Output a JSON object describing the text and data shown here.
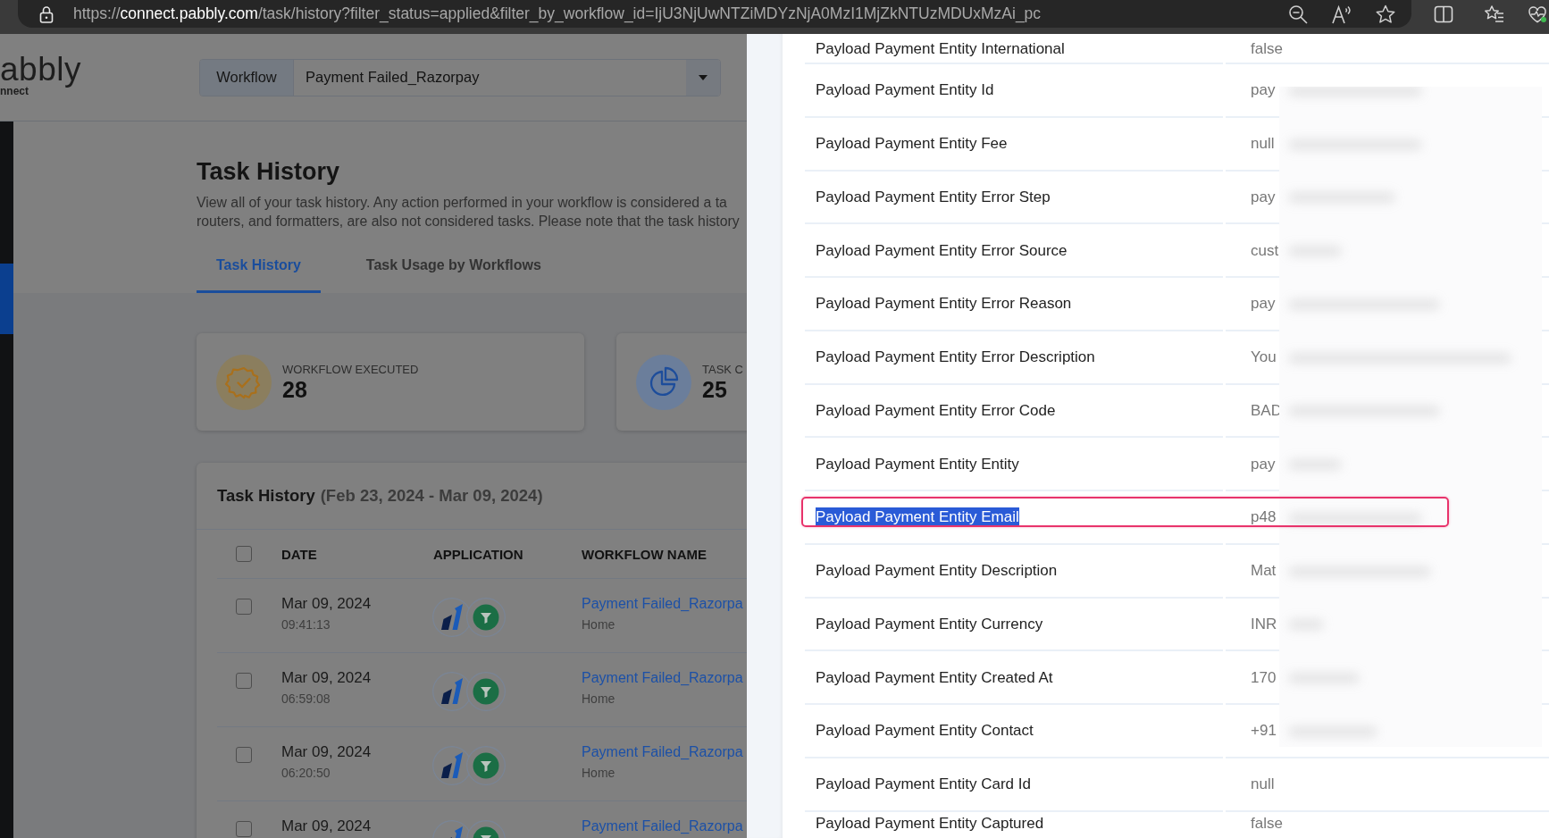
{
  "browser": {
    "url_scheme": "https://",
    "url_host": "connect.pabbly.com",
    "url_path": "/task/history?filter_status=applied&filter_by_workflow_id=IjU3NjUwNTZiMDYzNjA0MzI1MjZkNTUzMDUxMzAi_pc"
  },
  "header": {
    "logo": "abbly",
    "logo_sub": "nnect",
    "workflow_label": "Workflow",
    "workflow_value": "Payment Failed_Razorpay"
  },
  "page": {
    "title": "Task History",
    "description": [
      "View all of your task history. Any action performed in your workflow is considered a ta",
      "routers, and formatters, are also not considered tasks. Please note that the task history"
    ],
    "tabs": [
      {
        "label": "Task History",
        "selected": true
      },
      {
        "label": "Task Usage by Workflows",
        "selected": false
      }
    ]
  },
  "stats": [
    {
      "kind": "executed",
      "label": "WORKFLOW EXECUTED",
      "value": "28"
    },
    {
      "kind": "consumed",
      "label": "TASK C",
      "value": "25"
    }
  ],
  "task_table": {
    "title": "Task History",
    "range": "(Feb 23, 2024 - Mar 09, 2024)",
    "header_checked": false,
    "columns": [
      "DATE",
      "APPLICATION",
      "WORKFLOW NAME"
    ],
    "rows": [
      {
        "checked": false,
        "date": "Mar 09, 2024",
        "time": "09:41:13",
        "workflow": "Payment Failed_Razorpa",
        "folder": "Home"
      },
      {
        "checked": false,
        "date": "Mar 09, 2024",
        "time": "06:59:08",
        "workflow": "Payment Failed_Razorpa",
        "folder": "Home"
      },
      {
        "checked": false,
        "date": "Mar 09, 2024",
        "time": "06:20:50",
        "workflow": "Payment Failed_Razorpa",
        "folder": "Home"
      },
      {
        "checked": false,
        "date": "Mar 09, 2024",
        "workflow": "Payment Failed_Razorpa"
      }
    ]
  },
  "payload": {
    "rows": [
      {
        "field": "Payload Payment Entity International",
        "value": "false",
        "selected_text": false,
        "circled": false
      },
      {
        "field": "Payload Payment Entity Id",
        "value": "pay",
        "selected_text": false,
        "circled": false
      },
      {
        "field": "Payload Payment Entity Fee",
        "value": "null",
        "selected_text": false,
        "circled": false
      },
      {
        "field": "Payload Payment Entity Error Step",
        "value": "pay",
        "selected_text": false,
        "circled": false
      },
      {
        "field": "Payload Payment Entity Error Source",
        "value": "cust",
        "selected_text": false,
        "circled": false
      },
      {
        "field": "Payload Payment Entity Error Reason",
        "value": "pay",
        "selected_text": false,
        "circled": false
      },
      {
        "field": "Payload Payment Entity Error Description",
        "value": "You",
        "selected_text": false,
        "circled": false
      },
      {
        "field": "Payload Payment Entity Error Code",
        "value": "BAD",
        "selected_text": false,
        "circled": false
      },
      {
        "field": "Payload Payment Entity Entity",
        "value": "pay",
        "selected_text": false,
        "circled": false
      },
      {
        "field": "Payload Payment Entity Email",
        "value": "p48",
        "selected_text": true,
        "circled": true
      },
      {
        "field": "Payload Payment Entity Description",
        "value": "Mat",
        "selected_text": false,
        "circled": false
      },
      {
        "field": "Payload Payment Entity Currency",
        "value": "INR",
        "selected_text": false,
        "circled": false
      },
      {
        "field": "Payload Payment Entity Created At",
        "value": "170",
        "selected_text": false,
        "circled": false
      },
      {
        "field": "Payload Payment Entity Contact",
        "value": "+91",
        "selected_text": false,
        "circled": false
      },
      {
        "field": "Payload Payment Entity Card Id",
        "value": "null",
        "selected_text": false,
        "circled": false
      },
      {
        "field": "Payload Payment Entity Captured",
        "value": "false",
        "selected_text": false,
        "circled": false
      }
    ]
  }
}
